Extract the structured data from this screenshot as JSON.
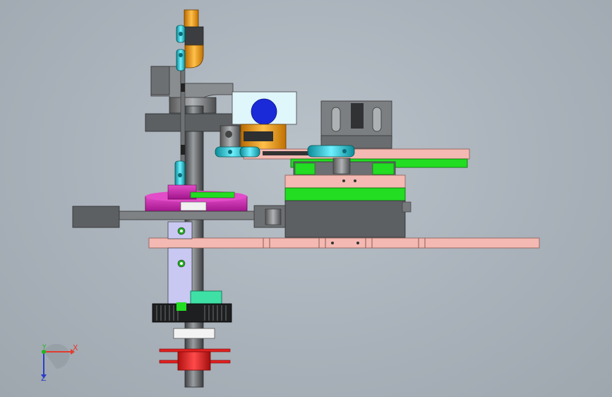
{
  "viewport": {
    "background": "#aab2bb"
  },
  "axes": {
    "x_label": "X",
    "y_label": "Y",
    "z_label": "Z",
    "x_color": "#e23b2f",
    "y_color": "#1fb61f",
    "z_color": "#2a3fc9"
  },
  "colors": {
    "gray_dark": "#5a5d60",
    "gray_mid": "#7f8285",
    "pink_plate": "#f2b6b0",
    "green_block": "#22dd22",
    "magenta_gear": "#d22fb4",
    "cyan_joint": "#2ec6d6",
    "orange_part": "#f0a020",
    "blue_disc": "#1a2ad8",
    "red_pulley": "#e02020",
    "lavender_block": "#c8c8f2",
    "teal_disc": "#3fe0a6"
  }
}
